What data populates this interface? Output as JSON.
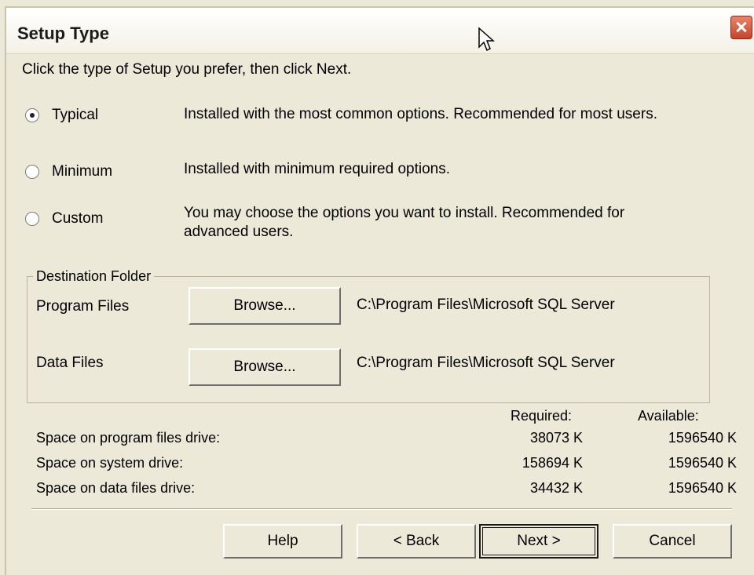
{
  "window": {
    "title": "Setup Type"
  },
  "instruction": "Click the type of Setup you prefer, then click Next.",
  "setup_options": [
    {
      "label": "Typical",
      "description": "Installed with the most common options. Recommended for most users.",
      "selected": true
    },
    {
      "label": "Minimum",
      "description": "Installed with minimum required options.",
      "selected": false
    },
    {
      "label": "Custom",
      "description": "You may choose the options you want to install. Recommended for advanced users.",
      "selected": false
    }
  ],
  "destination": {
    "legend": "Destination Folder",
    "program_files": {
      "label": "Program Files",
      "button": "Browse...",
      "path": "C:\\Program Files\\Microsoft SQL Server"
    },
    "data_files": {
      "label": "Data Files",
      "button": "Browse...",
      "path": "C:\\Program Files\\Microsoft SQL Server"
    }
  },
  "space": {
    "required_header": "Required:",
    "available_header": "Available:",
    "rows": [
      {
        "label": "Space on program files drive:",
        "required": "38073 K",
        "available": "1596540 K"
      },
      {
        "label": "Space on system drive:",
        "required": "158694 K",
        "available": "1596540 K"
      },
      {
        "label": "Space on data files drive:",
        "required": "34432 K",
        "available": "1596540 K"
      }
    ]
  },
  "buttons": {
    "help": "Help",
    "back": "< Back",
    "next": "Next >",
    "cancel": "Cancel"
  },
  "icons": {
    "close": "close-icon",
    "cursor": "mouse-pointer-icon"
  }
}
